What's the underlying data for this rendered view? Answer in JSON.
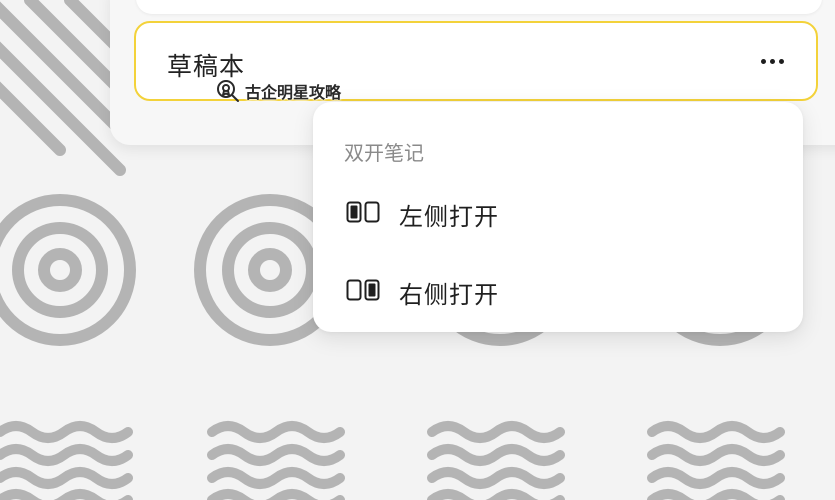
{
  "notebook": {
    "title": "草稿本",
    "more_icon": "more-horizontal-icon"
  },
  "watermark": {
    "text": "古企明星攻略",
    "icon": "search-award-icon"
  },
  "menu": {
    "heading": "双开笔记",
    "items": [
      {
        "label": "左侧打开",
        "icon": "split-left-icon"
      },
      {
        "label": "右侧打开",
        "icon": "split-right-icon"
      }
    ]
  },
  "colors": {
    "accent_border": "#f3d23a",
    "pattern": "#b4b4b4",
    "background": "#f3f3f3"
  }
}
